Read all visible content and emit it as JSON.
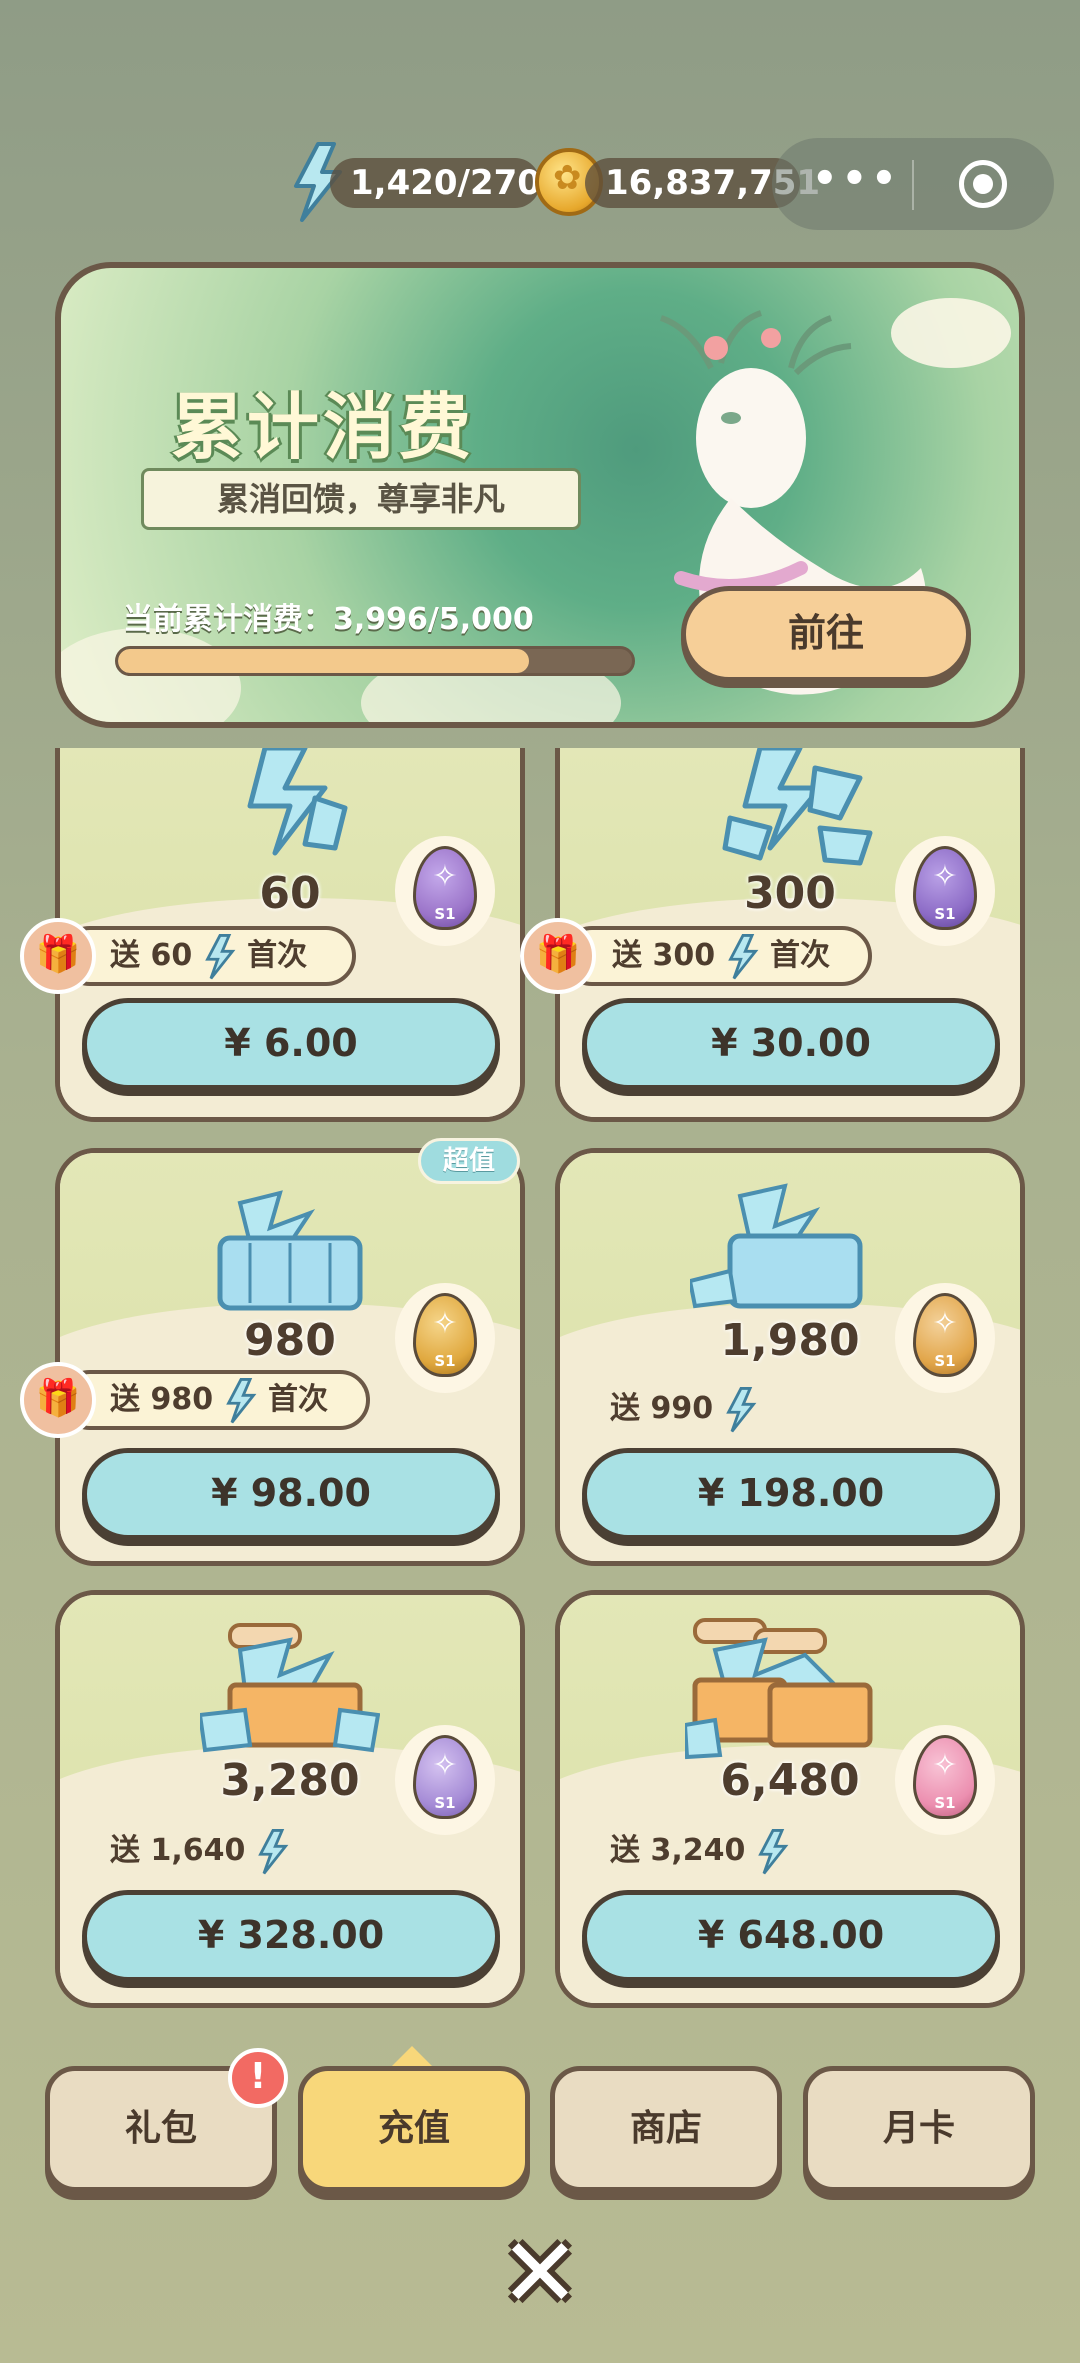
{
  "hud": {
    "energy": "1,420/270",
    "coins": "16,837,751",
    "more_icon": "more-dots-icon",
    "close_target_icon": "target-icon"
  },
  "banner": {
    "title": "累计消费",
    "subtitle": "累消回馈，尊享非凡",
    "progress_label": "当前累计消费：3,996/5,000",
    "progress_current": 3996,
    "progress_max": 5000,
    "go_label": "前往"
  },
  "packs": [
    {
      "amount": "60",
      "bonus_prefix": "送",
      "bonus": "60",
      "first_tag": "首次",
      "price": "¥ 6.00",
      "egg_color": "#9b74c9",
      "first_time": true
    },
    {
      "amount": "300",
      "bonus_prefix": "送",
      "bonus": "300",
      "first_tag": "首次",
      "price": "¥ 30.00",
      "egg_color": "#8c6bc6",
      "first_time": true
    },
    {
      "amount": "980",
      "bonus_prefix": "送",
      "bonus": "980",
      "first_tag": "首次",
      "price": "¥ 98.00",
      "egg_color": "#e0a83e",
      "first_time": true,
      "tag": "超值"
    },
    {
      "amount": "1,980",
      "bonus_prefix": "送",
      "bonus": "990",
      "price": "¥ 198.00",
      "egg_color": "#e2a64a",
      "first_time": false
    },
    {
      "amount": "3,280",
      "bonus_prefix": "送",
      "bonus": "1,640",
      "price": "¥ 328.00",
      "egg_color": "#a58bd6",
      "first_time": false
    },
    {
      "amount": "6,480",
      "bonus_prefix": "送",
      "bonus": "3,240",
      "price": "¥ 648.00",
      "egg_color": "#ec8fb0",
      "first_time": false
    }
  ],
  "egg_label": "S1",
  "tabs": [
    {
      "label": "礼包",
      "active": false,
      "alert": "!"
    },
    {
      "label": "充值",
      "active": true
    },
    {
      "label": "商店",
      "active": false
    },
    {
      "label": "月卡",
      "active": false
    }
  ],
  "colors": {
    "accent_teal": "#a9e1e4",
    "accent_yellow": "#f8d77a",
    "outline_brown": "#6b5847"
  }
}
